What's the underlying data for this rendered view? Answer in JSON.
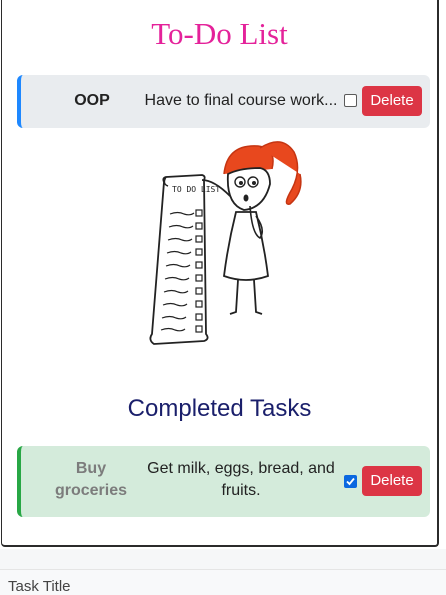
{
  "header": {
    "title": "To-Do List"
  },
  "active_tasks": [
    {
      "title": "OOP",
      "description": "Have to final course work...",
      "checked": false,
      "delete_label": "Delete"
    }
  ],
  "completed": {
    "heading": "Completed Tasks",
    "tasks": [
      {
        "title": "Buy groceries",
        "description": "Get milk, eggs, bread, and fruits.",
        "checked": true,
        "delete_label": "Delete"
      }
    ]
  },
  "illustration": {
    "note_text": "TO DO LIST",
    "icon": "todo-list-girl-illustration"
  },
  "form": {
    "task_title_label": "Task Title"
  },
  "colors": {
    "title": "#e4229a",
    "completed_heading": "#1a1f6b",
    "active_accent": "#1e88ff",
    "done_accent": "#28a745",
    "delete": "#dc3545"
  }
}
